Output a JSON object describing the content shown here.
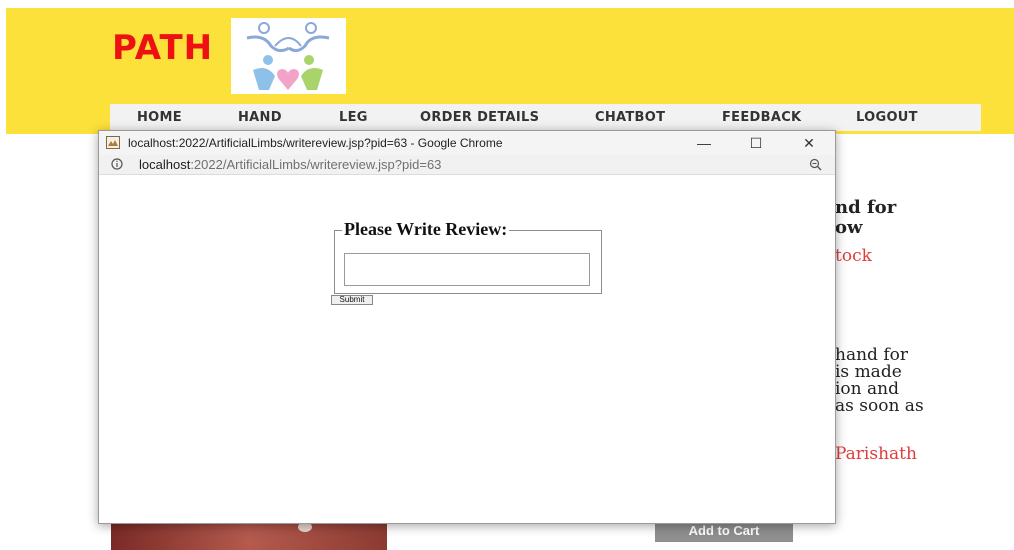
{
  "site": {
    "brand": "PATH",
    "nav": [
      "HOME",
      "HAND",
      "LEG",
      "ORDER DETAILS",
      "CHATBOT",
      "FEEDBACK",
      "LOGOUT"
    ]
  },
  "background_product": {
    "title_line1": "nd for",
    "title_line2": "ow",
    "stock": "tock",
    "desc_lines": [
      "hand for",
      "is made",
      "ion and",
      "as soon as"
    ],
    "seller": "Parishath",
    "add_to_cart": "Add to Cart"
  },
  "popup": {
    "window_title": "localhost:2022/ArtificialLimbs/writereview.jsp?pid=63 - Google Chrome",
    "url_host": "localhost",
    "url_rest": ":2022/ArtificialLimbs/writereview.jsp?pid=63",
    "legend": "Please Write Review:",
    "review_value": "",
    "submit_label": "Submit"
  },
  "colors": {
    "header_bg": "#fce13a",
    "brand_red": "#ee1111",
    "accent_red": "#e03c3c"
  }
}
